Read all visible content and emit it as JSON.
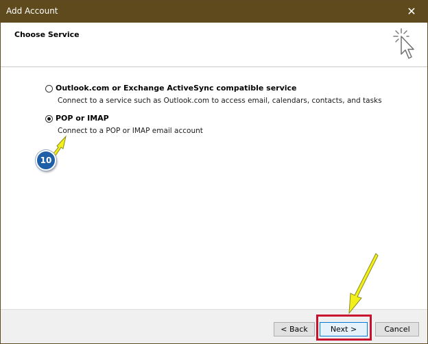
{
  "window": {
    "title": "Add Account",
    "close_glyph": "✕"
  },
  "header": {
    "title": "Choose Service",
    "icon": "wizard-cursor-icon"
  },
  "options": [
    {
      "label": "Outlook.com or Exchange ActiveSync compatible service",
      "description": "Connect to a service such as Outlook.com to access email, calendars, contacts, and tasks",
      "selected": false
    },
    {
      "label": "POP or IMAP",
      "description": "Connect to a POP or IMAP email account",
      "selected": true
    }
  ],
  "annotation": {
    "step_number": "10",
    "arrow_color": "#f2ef1a",
    "highlight_color": "#c8102e",
    "badge_color": "#1f5fa8"
  },
  "footer": {
    "back_label": "< Back",
    "next_label": "Next >",
    "cancel_label": "Cancel"
  }
}
